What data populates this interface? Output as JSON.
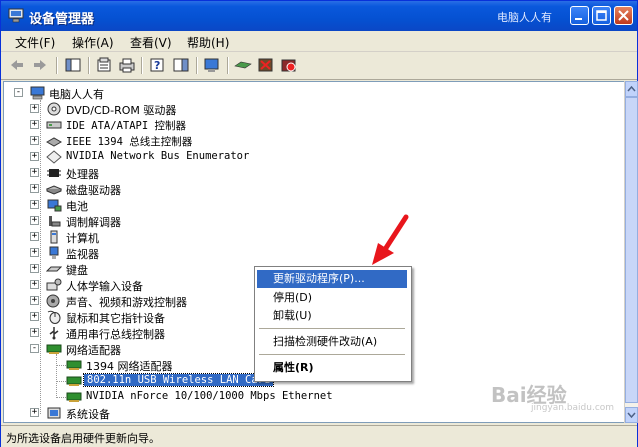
{
  "window": {
    "title": "设备管理器",
    "watermark_title": "电脑人人有"
  },
  "menubar": [
    {
      "label": "文件(F)"
    },
    {
      "label": "操作(A)"
    },
    {
      "label": "查看(V)"
    },
    {
      "label": "帮助(H)"
    }
  ],
  "tree": {
    "root": "电脑人人有",
    "items": [
      {
        "label": "DVD/CD-ROM 驱动器",
        "icon": "cdrom-icon"
      },
      {
        "label": "IDE ATA/ATAPI 控制器",
        "icon": "ide-controller-icon"
      },
      {
        "label": "IEEE 1394 总线主控制器",
        "icon": "ieee1394-icon"
      },
      {
        "label": "NVIDIA Network Bus Enumerator",
        "icon": "network-bus-icon"
      },
      {
        "label": "处理器",
        "icon": "processor-icon"
      },
      {
        "label": "磁盘驱动器",
        "icon": "disk-drive-icon"
      },
      {
        "label": "电池",
        "icon": "battery-icon"
      },
      {
        "label": "调制解调器",
        "icon": "modem-icon"
      },
      {
        "label": "计算机",
        "icon": "computer-icon"
      },
      {
        "label": "监视器",
        "icon": "monitor-icon"
      },
      {
        "label": "键盘",
        "icon": "keyboard-icon"
      },
      {
        "label": "人体学输入设备",
        "icon": "hid-icon"
      },
      {
        "label": "声音、视频和游戏控制器",
        "icon": "sound-icon"
      },
      {
        "label": "鼠标和其它指针设备",
        "icon": "mouse-icon"
      },
      {
        "label": "通用串行总线控制器",
        "icon": "usb-icon"
      },
      {
        "label": "网络适配器",
        "icon": "network-adapter-icon"
      }
    ],
    "network_children": [
      {
        "label": "1394 网络适配器"
      },
      {
        "label": "802.11n USB Wireless LAN Card"
      },
      {
        "label": "NVIDIA nForce 10/100/1000 Mbps Ethernet"
      }
    ],
    "last_item": "系统设备"
  },
  "context_menu": {
    "update_driver": "更新驱动程序(P)...",
    "disable": "停用(D)",
    "uninstall": "卸载(U)",
    "scan": "扫描检测硬件改动(A)",
    "properties": "属性(R)"
  },
  "status": {
    "text": "为所选设备启用硬件更新向导。"
  },
  "watermark": {
    "brand": "Bai经验",
    "sub": "jingyan.baidu.com"
  },
  "colors": {
    "selection": "#316ac5",
    "titlebar": "#0551d2",
    "arrow": "#e8161c"
  }
}
